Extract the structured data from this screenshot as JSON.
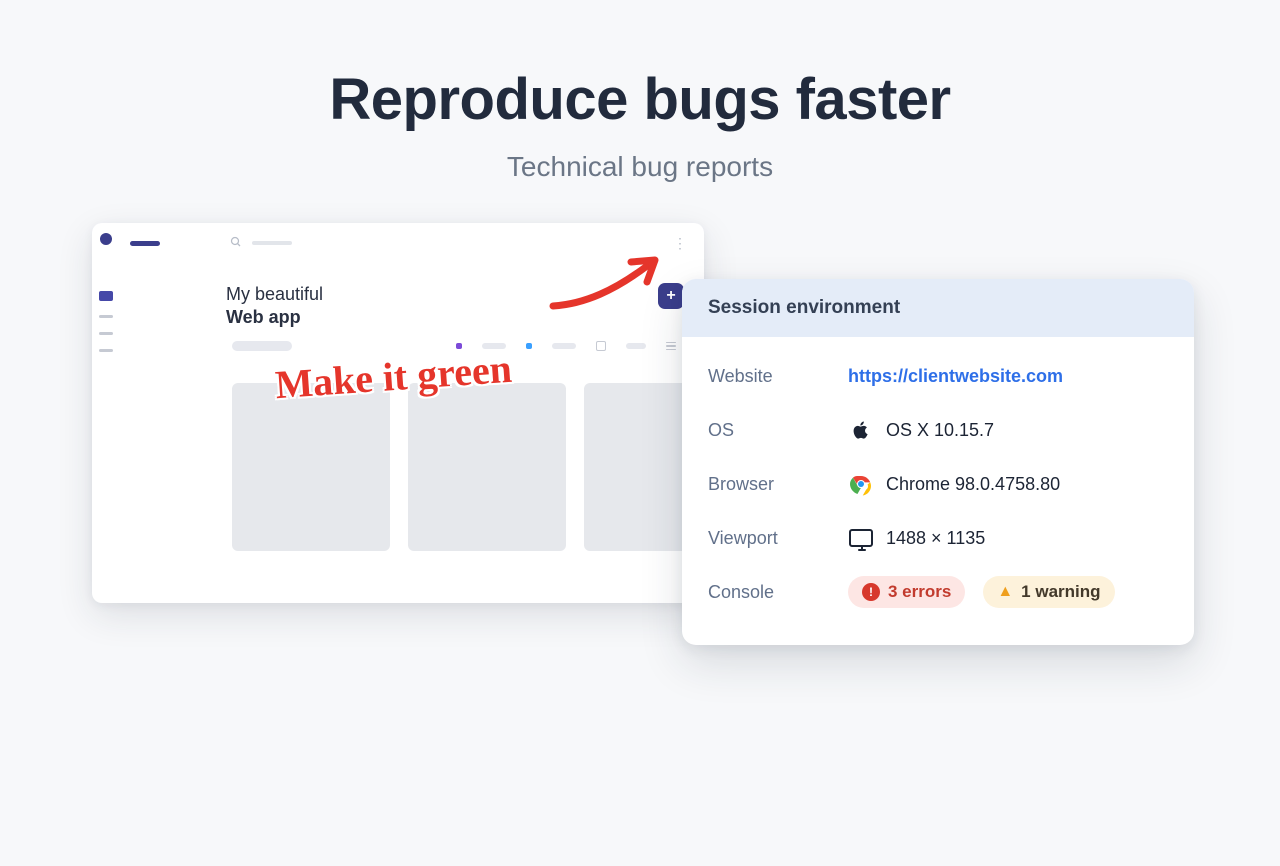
{
  "hero": {
    "headline": "Reproduce bugs faster",
    "subhead": "Technical bug reports"
  },
  "app": {
    "title_line1": "My beautiful",
    "title_line2": "Web app",
    "add_glyph": "+",
    "annotation": "Make it green"
  },
  "session": {
    "header": "Session environment",
    "rows": {
      "website": {
        "label": "Website",
        "value": "https://clientwebsite.com"
      },
      "os": {
        "label": "OS",
        "value": "OS X 10.15.7"
      },
      "browser": {
        "label": "Browser",
        "value": "Chrome 98.0.4758.80"
      },
      "viewport": {
        "label": "Viewport",
        "value": "1488 × 1135"
      },
      "console": {
        "label": "Console",
        "errors": "3 errors",
        "warnings": "1 warning"
      }
    }
  }
}
